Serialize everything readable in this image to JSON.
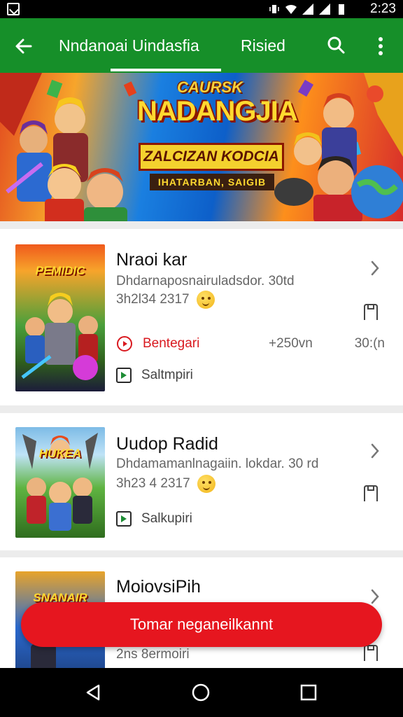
{
  "status_bar": {
    "time": "2:23"
  },
  "app_bar": {
    "tabs": [
      {
        "label": "Nndanoai Uindasfia",
        "selected": true
      },
      {
        "label": "Risied",
        "selected": false
      }
    ]
  },
  "banner": {
    "subtitle": "CAURSK",
    "title": "NADANGJIA",
    "plate": "ZALCIZAN KODCIA",
    "strap": "IHATARBAN, SAIGIB"
  },
  "cards": [
    {
      "title": "Nraoi kar",
      "description": "Dhdarnaposnairuladsdor. 30td",
      "meta": "3h2l34 2317",
      "thumb_label": "PEMIDIC",
      "status": "Bentegari",
      "size": "+250vn",
      "percent": "30:(n",
      "action": "Saltmpiri"
    },
    {
      "title": "Uudop Radid",
      "description": "Dhdamamanlnagaiin. lokdar. 30 rd",
      "meta": "3h23 4 2317",
      "thumb_label": "HUKEA",
      "action": "Salkupiri"
    },
    {
      "title": "MoiovsiPih",
      "meta": "2ns 8ermoiri",
      "thumb_label": "SNANAIR"
    }
  ],
  "fab": {
    "label": "Tomar neganeilkannt"
  },
  "colors": {
    "app_bar": "#168f29",
    "accent_red": "#e6161f",
    "status_red": "#d9191f"
  }
}
